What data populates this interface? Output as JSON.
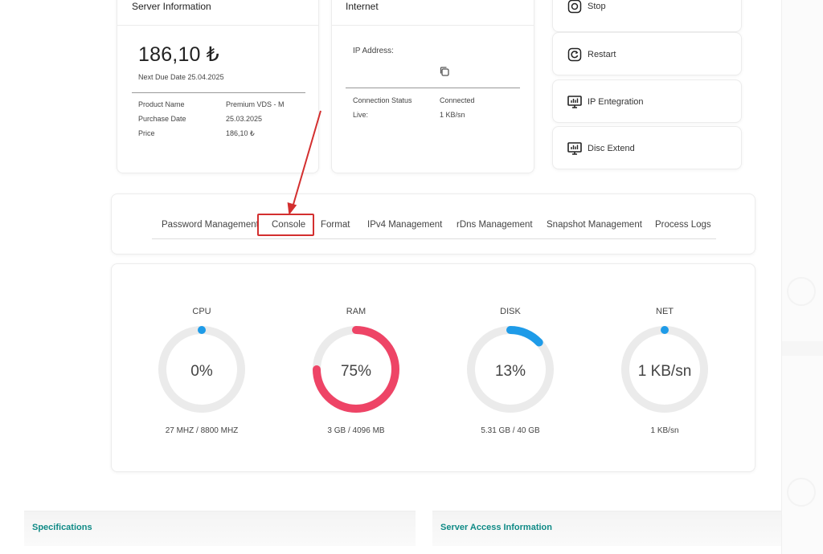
{
  "server_info": {
    "title": "Server Information",
    "price": "186,10 ₺",
    "due_date": "Next Due Date 25.04.2025",
    "rows": [
      {
        "key": "Product Name",
        "value": "Premium VDS - M"
      },
      {
        "key": "Purchase Date",
        "value": "25.03.2025"
      },
      {
        "key": "Price",
        "value": "186,10 ₺"
      }
    ]
  },
  "internet": {
    "title": "Internet",
    "ip_label": "IP Address:",
    "copy_icon": "copy-icon",
    "rows": [
      {
        "key": "Connection Status",
        "value": "Connected"
      },
      {
        "key": "Live:",
        "value": "1 KB/sn"
      }
    ]
  },
  "actions": [
    {
      "label": "Stop",
      "icon": "power-icon"
    },
    {
      "label": "Restart",
      "icon": "restart-icon"
    },
    {
      "label": "IP Entegration",
      "icon": "monitor-icon"
    },
    {
      "label": "Disc Extend",
      "icon": "monitor-icon"
    }
  ],
  "tabs": [
    "Password Management",
    "Console",
    "Format",
    "IPv4 Management",
    "rDns Management",
    "Snapshot Management",
    "Process Logs"
  ],
  "highlighted_tab": "Console",
  "metrics": [
    {
      "label": "CPU",
      "value": "0%",
      "sub": "27 MHZ / 8800 MHZ",
      "fraction": 0,
      "color": "#1e9be8"
    },
    {
      "label": "RAM",
      "value": "75%",
      "sub": "3 GB / 4096 MB",
      "fraction": 0.75,
      "color": "#ee4466"
    },
    {
      "label": "DISK",
      "value": "13%",
      "sub": "5.31 GB / 40 GB",
      "fraction": 0.13,
      "color": "#1e9be8"
    },
    {
      "label": "NET",
      "value": "1 KB/sn",
      "sub": "1 KB/sn",
      "fraction": 0,
      "color": "#1e9be8"
    }
  ],
  "bottom": {
    "specifications": "Specifications",
    "server_access": "Server Access Information"
  },
  "colors": {
    "annotation": "#d32f2f",
    "accent_teal": "#0f8a86",
    "ring_track": "#ebebeb"
  }
}
